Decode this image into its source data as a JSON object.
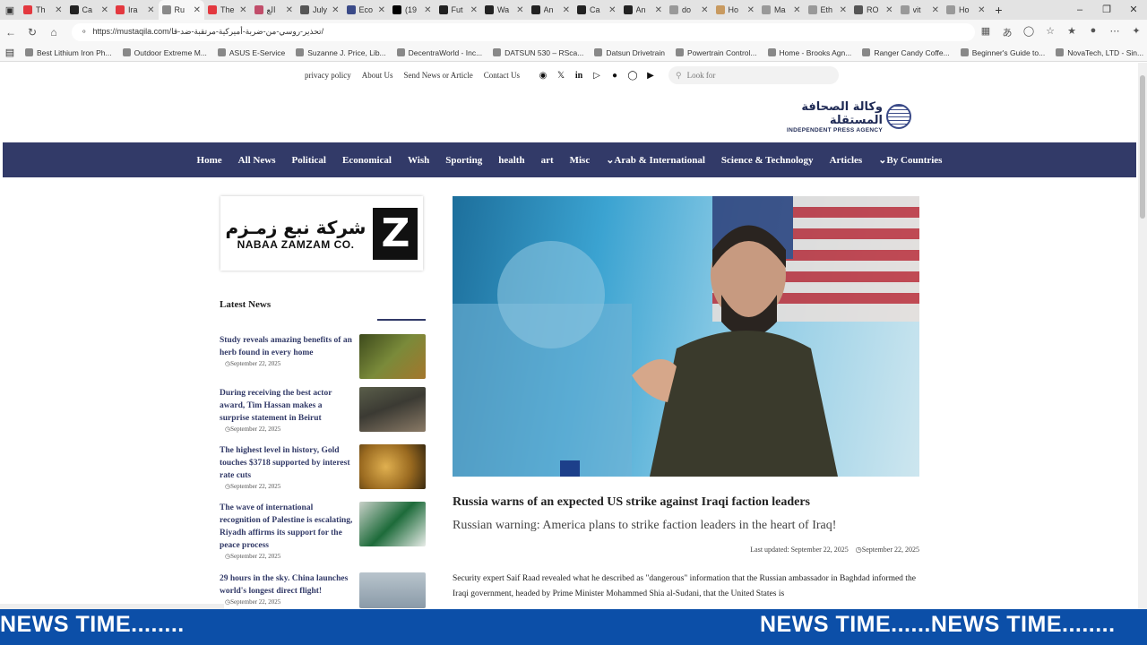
{
  "browser": {
    "tabs": [
      {
        "label": "Th",
        "color": "#e3383f"
      },
      {
        "label": "Ca",
        "color": "#222222"
      },
      {
        "label": "Ira",
        "color": "#e3383f"
      },
      {
        "label": "Ru",
        "color": "#8a8a8a"
      },
      {
        "label": "The",
        "color": "#e3383f"
      },
      {
        "label": "الع",
        "color": "#c14d6a"
      },
      {
        "label": "July",
        "color": "#555555"
      },
      {
        "label": "Eco",
        "color": "#3a4a88"
      },
      {
        "label": "(19",
        "color": "#000000"
      },
      {
        "label": "Fut",
        "color": "#222222"
      },
      {
        "label": "Wa",
        "color": "#222222"
      },
      {
        "label": "An",
        "color": "#222222"
      },
      {
        "label": "Ca",
        "color": "#222222"
      },
      {
        "label": "An",
        "color": "#222222"
      },
      {
        "label": "do",
        "color": "#999999"
      },
      {
        "label": "Ho",
        "color": "#c89a60"
      },
      {
        "label": "Ma",
        "color": "#999999"
      },
      {
        "label": "Eth",
        "color": "#999999"
      },
      {
        "label": "RO",
        "color": "#555555"
      },
      {
        "label": "vit",
        "color": "#999999"
      },
      {
        "label": "Ho",
        "color": "#999999"
      }
    ],
    "url": "https://mustaqila.com/تحذير-روسي-من-ضربة-أميركية-مرتقبة-ضد-قا/",
    "bookmarks": [
      "Best Lithium Iron Ph...",
      "Outdoor Extreme M...",
      "ASUS E-Service",
      "Suzanne J. Price, Lib...",
      "DecentraWorld - Inc...",
      "DATSUN 530 – RSca...",
      "Datsun Drivetrain",
      "Powertrain Control...",
      "Home - Brooks Agn...",
      "Ranger Candy Coffe...",
      "Beginner's Guide to...",
      "NovaTech, LTD - Sin..."
    ]
  },
  "site": {
    "top_links": [
      "privacy policy",
      "About Us",
      "Send News or Article",
      "Contact Us"
    ],
    "social_icons": [
      "facebook-icon",
      "x-icon",
      "linkedin-icon",
      "youtube-icon",
      "apple-icon",
      "instagram-icon",
      "play-icon"
    ],
    "search_placeholder": "Look for",
    "logo_arabic": "وكالة الصحافة المستقلة",
    "logo_english": "INDEPENDENT PRESS AGENCY",
    "nav": [
      "Home",
      "All News",
      "Political",
      "Economical",
      "Wish",
      "Sporting",
      "health",
      "art",
      "Misc",
      "⌄Arab & International",
      "Science & Technology",
      "Articles",
      "⌄By Countries"
    ],
    "nav_color": "#323a68",
    "ad_arabic": "شركة نبع زمـزم",
    "ad_english": "NABAA ZAMZAM CO.",
    "ad_letter": "Z",
    "latest_news_title": "Latest News",
    "latest_news": [
      {
        "title": "Study reveals amazing benefits of an herb found in every home",
        "date": "September 22, 2025"
      },
      {
        "title": "During receiving the best actor award, Tim Hassan makes a surprise statement in Beirut",
        "date": "September 22, 2025"
      },
      {
        "title": "The highest level in history, Gold touches $3718 supported by interest rate cuts",
        "date": "September 22, 2025"
      },
      {
        "title": "The wave of international recognition of Palestine is escalating, Riyadh affirms its support for the peace process",
        "date": "September 22, 2025"
      },
      {
        "title": "29 hours in the sky. China launches world's longest direct flight!",
        "date": "September 22, 2025"
      }
    ],
    "article": {
      "headline": "Russia warns of an expected US strike against Iraqi faction leaders",
      "subheadline": "Russian warning: America plans to strike faction leaders in the heart of Iraq!",
      "last_updated": "Last updated: September 22, 2025",
      "date": "September 22, 2025",
      "body": "Security expert Saif Raad revealed what he described as \"dangerous\" information that the Russian ambassador in Baghdad informed the Iraqi government, headed by Prime Minister Mohammed Shia al-Sudani, that the United States is"
    },
    "ticker_text_left": "NEWS TIME........",
    "ticker_text_right": "NEWS TIME......NEWS TIME........",
    "ticker_color": "#0c4fa8"
  }
}
